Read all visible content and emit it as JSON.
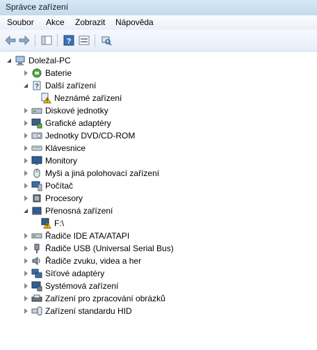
{
  "window": {
    "title": "Správce zařízení"
  },
  "menu": [
    "Soubor",
    "Akce",
    "Zobrazit",
    "Nápověda"
  ],
  "toolbar": {
    "buttons": [
      "back-arrow-icon",
      "forward-arrow-icon",
      "show-hide-tree-icon",
      "help-icon",
      "properties-icon",
      "scan-hardware-icon"
    ]
  },
  "tree": {
    "root": "Doležal-PC",
    "items": [
      {
        "label": "Baterie",
        "expanded": false,
        "icon": "battery-icon"
      },
      {
        "label": "Další zařízení",
        "expanded": true,
        "icon": "other-devices-icon",
        "children": [
          {
            "label": "Neznámé zařízení",
            "icon": "unknown-device-warning-icon"
          }
        ]
      },
      {
        "label": "Diskové jednotky",
        "expanded": false,
        "icon": "disk-drive-icon"
      },
      {
        "label": "Grafické adaptéry",
        "expanded": false,
        "icon": "display-adapter-icon"
      },
      {
        "label": "Jednotky DVD/CD-ROM",
        "expanded": false,
        "icon": "dvd-drive-icon"
      },
      {
        "label": "Klávesnice",
        "expanded": false,
        "icon": "keyboard-icon"
      },
      {
        "label": "Monitory",
        "expanded": false,
        "icon": "monitor-icon"
      },
      {
        "label": "Myši a jiná polohovací zařízení",
        "expanded": false,
        "icon": "mouse-icon"
      },
      {
        "label": "Počítač",
        "expanded": false,
        "icon": "computer-icon"
      },
      {
        "label": "Procesory",
        "expanded": false,
        "icon": "processor-icon"
      },
      {
        "label": "Přenosná zařízení",
        "expanded": true,
        "icon": "portable-device-icon",
        "children": [
          {
            "label": "F:\\",
            "icon": "portable-device-warning-icon"
          }
        ]
      },
      {
        "label": "Řadiče IDE ATA/ATAPI",
        "expanded": false,
        "icon": "ide-controller-icon"
      },
      {
        "label": "Řadiče USB (Universal Serial Bus)",
        "expanded": false,
        "icon": "usb-icon"
      },
      {
        "label": "Řadiče zvuku, videa a her",
        "expanded": false,
        "icon": "sound-icon"
      },
      {
        "label": "Síťové adaptéry",
        "expanded": false,
        "icon": "network-adapter-icon"
      },
      {
        "label": "Systémová zařízení",
        "expanded": false,
        "icon": "system-device-icon"
      },
      {
        "label": "Zařízení pro zpracování obrázků",
        "expanded": false,
        "icon": "imaging-device-icon"
      },
      {
        "label": "Zařízení standardu HID",
        "expanded": false,
        "icon": "hid-icon"
      }
    ]
  },
  "colors": {
    "accent": "#3c7fb1",
    "warning": "#f5c400"
  }
}
